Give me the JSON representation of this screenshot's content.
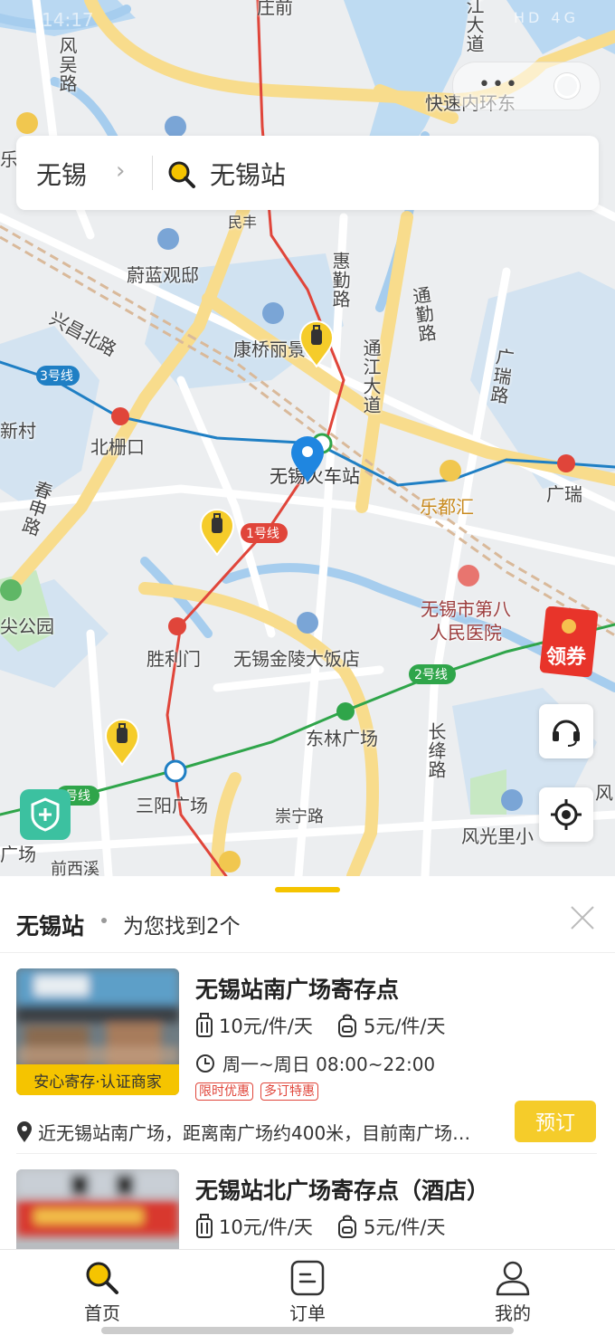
{
  "status_bar": {
    "time": "14:17",
    "icons": "HD 4G"
  },
  "map": {
    "labels": {
      "qianqian": "庄前",
      "fengwu_road": "风吴路",
      "tongjiang_top": "江大道",
      "fast_ring": "快速内环东",
      "le_left": "乐",
      "min": "民丰",
      "weilan": "蔚蓝观邸",
      "huiqin_road": "惠勤路",
      "tongqin_road": "通勤路",
      "xingchang_road": "兴昌北路",
      "kangqiao": "康桥丽景",
      "tongjiang_road": "通江大道",
      "guangrui_road": "广瑞路",
      "line3": "3号线",
      "xincun": "新村",
      "beizhakou": "北栅口",
      "station": "无锡火车站",
      "ledu": "乐都汇",
      "guangrui": "广瑞",
      "shengtian_road": "春申路",
      "line1": "1号线",
      "park": "尖公园",
      "hospital": "无锡市第八人民医院",
      "shenglimen": "胜利门",
      "jinling": "无锡金陵大饭店",
      "line2": "2号线",
      "donglin": "东林广场",
      "changjiang_road": "长绛路",
      "sanyang": "三阳广场",
      "chongning": "崇宁路",
      "fengguang": "风光里小",
      "qianxixi": "前西溪",
      "guangchang_left": "广场",
      "line_left": "号线",
      "feng_right": "风"
    },
    "coupon_label": "领券"
  },
  "search": {
    "city": "无锡",
    "query": "无锡站"
  },
  "panel": {
    "title": "无锡站",
    "count_text": "为您找到2个",
    "results": [
      {
        "name": "无锡站南广场寄存点",
        "badge": "安心寄存·认证商家",
        "price_luggage": "10元/件/天",
        "price_bag": "5元/件/天",
        "hours": "周一~周日 08:00~22:00",
        "tags": [
          "限时优惠",
          "多订特惠"
        ],
        "address": "近无锡站南广场，距离南广场约400米，目前南广场…",
        "book_label": "预订"
      },
      {
        "name": "无锡站北广场寄存点（酒店）",
        "price_luggage": "10元/件/天",
        "price_bag": "5元/件/天"
      }
    ]
  },
  "tabs": [
    {
      "label": "首页",
      "icon": "search-icon",
      "active": true
    },
    {
      "label": "订单",
      "icon": "order-icon",
      "active": false
    },
    {
      "label": "我的",
      "icon": "profile-icon",
      "active": false
    }
  ],
  "colors": {
    "accent": "#f5c400",
    "line1": "#e0453a",
    "line2": "#2fa54a",
    "line3": "#1f7fc4"
  }
}
